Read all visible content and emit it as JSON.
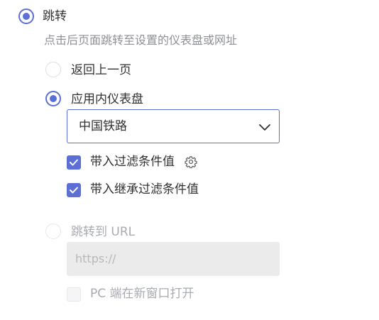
{
  "accent_color": "#5b6fd6",
  "jump": {
    "label": "跳转",
    "description": "点击后页面跳转至设置的仪表盘或网址",
    "selected": true
  },
  "options": {
    "back": {
      "label": "返回上一页",
      "selected": false
    },
    "dashboard": {
      "label": "应用内仪表盘",
      "selected": true,
      "select_value": "中国铁路",
      "select_icon": "chevron-down-icon",
      "filter_checkbox": {
        "label": "带入过滤条件值",
        "checked": true,
        "icon": "gear-icon"
      },
      "inherit_checkbox": {
        "label": "带入继承过滤条件值",
        "checked": true
      }
    },
    "url": {
      "label": "跳转到 URL",
      "selected": false,
      "disabled": true,
      "input_placeholder": "https://",
      "new_window_checkbox": {
        "label": "PC 端在新窗口打开",
        "checked": false,
        "disabled": true
      }
    }
  }
}
